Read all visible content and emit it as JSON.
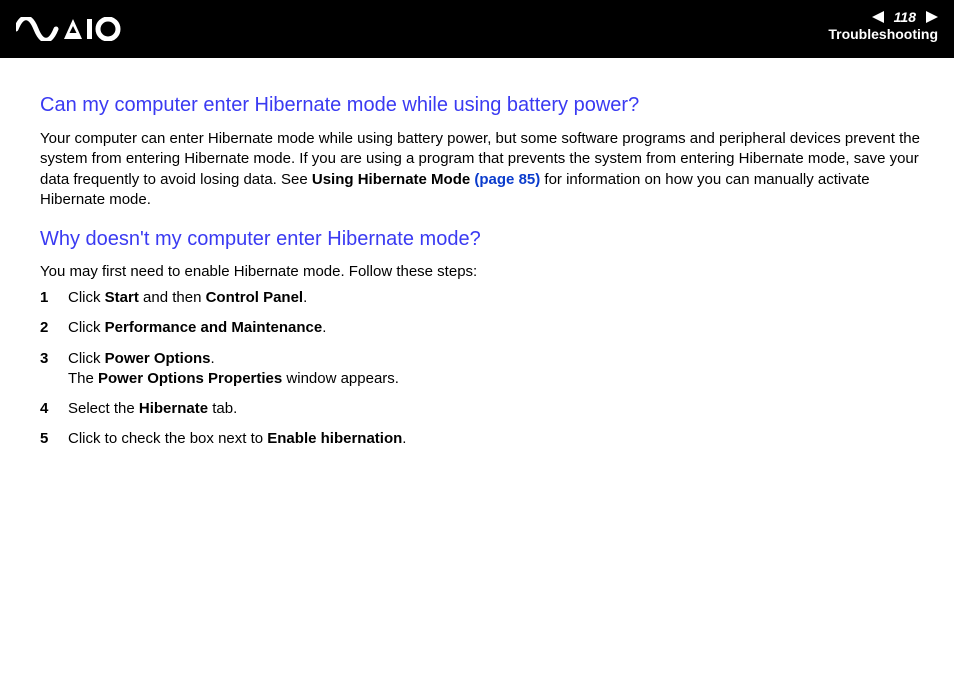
{
  "header": {
    "page_number": "118",
    "section": "Troubleshooting",
    "brand": "VAIO"
  },
  "content": {
    "q1": {
      "heading": "Can my computer enter Hibernate mode while using battery power?",
      "para_pre": "Your computer can enter Hibernate mode while using battery power, but some software programs and peripheral devices prevent the system from entering Hibernate mode. If you are using a program that prevents the system from entering Hibernate mode, save your data frequently to avoid losing data. See ",
      "para_bold": "Using Hibernate Mode ",
      "para_link": "(page 85)",
      "para_post": " for information on how you can manually activate Hibernate mode."
    },
    "q2": {
      "heading": "Why doesn't my computer enter Hibernate mode?",
      "intro": "You may first need to enable Hibernate mode. Follow these steps:",
      "steps": [
        {
          "pre": "Click ",
          "b1": "Start",
          "mid": " and then ",
          "b2": "Control Panel",
          "post": "."
        },
        {
          "pre": "Click ",
          "b1": "Performance and Maintenance",
          "post": "."
        },
        {
          "pre": "Click ",
          "b1": "Power Options",
          "post": ".",
          "line2_pre": "The ",
          "line2_b": "Power Options Properties",
          "line2_post": " window appears."
        },
        {
          "pre": "Select the ",
          "b1": "Hibernate",
          "post": " tab."
        },
        {
          "pre": "Click to check the box next to ",
          "b1": "Enable hibernation",
          "post": "."
        }
      ]
    }
  }
}
